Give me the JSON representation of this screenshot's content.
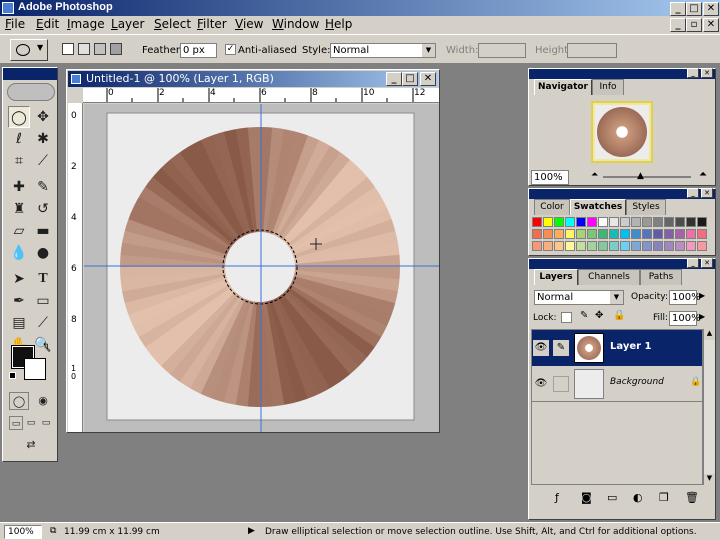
{
  "app": {
    "title": "Adobe Photoshop"
  },
  "menu": [
    "File",
    "Edit",
    "Image",
    "Layer",
    "Select",
    "Filter",
    "View",
    "Window",
    "Help"
  ],
  "options": {
    "feather_label": "Feather:",
    "feather_value": "0 px",
    "antialias_label": "Anti-aliased",
    "style_label": "Style:",
    "style_value": "Normal",
    "width_label": "Width:",
    "height_label": "Height:"
  },
  "document": {
    "title": "Untitled-1 @ 100% (Layer 1, RGB)",
    "ruler_top": [
      "0",
      "2",
      "4",
      "6",
      "8",
      "10",
      "12"
    ],
    "ruler_left": [
      "0",
      "2",
      "4",
      "6",
      "8",
      "1\n0"
    ],
    "layer_colors": {
      "dark": "#8a5a48",
      "light": "#e2c0ac",
      "background": "#ececec"
    },
    "guide_color": "#3a6fd8"
  },
  "navigator": {
    "tabs": [
      "Navigator",
      "Info"
    ],
    "zoom": "100%"
  },
  "swatches": {
    "tabs": [
      "Color",
      "Swatches",
      "Styles"
    ],
    "colors": [
      "#ff0000",
      "#ffff00",
      "#00ff00",
      "#00ffff",
      "#0000ff",
      "#ff00ff",
      "#ffffff",
      "#e6e6e6",
      "#cccccc",
      "#b3b3b3",
      "#999999",
      "#808080",
      "#666666",
      "#4d4d4d",
      "#333333",
      "#1a1a1a",
      "#f26c4f",
      "#f68e55",
      "#fbaf5d",
      "#fff568",
      "#acd372",
      "#7cc576",
      "#3bb878",
      "#1abbb4",
      "#00bff3",
      "#438ccb",
      "#5574b9",
      "#605ca8",
      "#855fa8",
      "#a763a8",
      "#f06ea9",
      "#f26d7d",
      "#f7977a",
      "#f9ad81",
      "#fdc68a",
      "#fff79a",
      "#c4df9b",
      "#a3d39c",
      "#82ca9d",
      "#7bcdc8",
      "#6ecff6",
      "#7ea7d8",
      "#8493ca",
      "#8882be",
      "#a187be",
      "#bc8dbf",
      "#f49ac2",
      "#f6989d"
    ]
  },
  "layers": {
    "tabs": [
      "Layers",
      "Channels",
      "Paths"
    ],
    "blend_mode": "Normal",
    "opacity_label": "Opacity:",
    "opacity_value": "100%",
    "lock_label": "Lock:",
    "fill_label": "Fill:",
    "fill_value": "100%",
    "items": [
      {
        "name": "Layer 1",
        "selected": true
      },
      {
        "name": "Background",
        "selected": false
      }
    ]
  },
  "status": {
    "zoom": "100%",
    "doc_size": "11.99 cm x 11.99 cm",
    "hint": "Draw elliptical selection or move selection outline.  Use Shift, Alt, and Ctrl for additional options."
  },
  "icons": {
    "caption_minimize": "_",
    "caption_maximize": "□",
    "caption_close": "✕"
  }
}
